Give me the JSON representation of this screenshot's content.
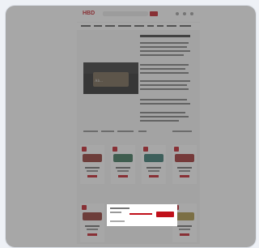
{
  "site": {
    "logo": "HBD"
  },
  "video": {
    "caption": "Ab..."
  },
  "colors": {
    "brand": "#c0101a",
    "overlay": "#505050",
    "background": "#eef1f6"
  },
  "products": [
    {
      "loco_color": "#8a2a24"
    },
    {
      "loco_color": "#2f6a4f"
    },
    {
      "loco_color": "#2a6f66"
    },
    {
      "loco_color": "#9a2424"
    }
  ]
}
